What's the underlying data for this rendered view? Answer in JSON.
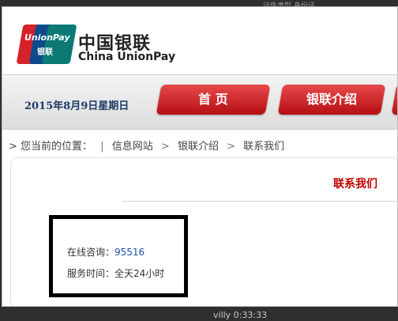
{
  "background": {
    "top_right_text": "证件类型  身份证",
    "bottom_text": "villy 0:33:33"
  },
  "brand": {
    "logo_top": "UnionPay",
    "logo_bottom": "银联",
    "name_cn": "中国银联",
    "name_en": "China UnionPay",
    "colors": {
      "red": "#d6222a",
      "blue": "#0c4a8c",
      "teal": "#0b7a74"
    }
  },
  "nav": {
    "date": "2015年8月9日星期日",
    "tabs": [
      "首 页",
      "银联介绍"
    ]
  },
  "breadcrumb": {
    "prefix": "您当前的位置：",
    "divider": "|",
    "items": [
      "信息网站",
      "银联介绍",
      "联系我们"
    ],
    "separator": ">"
  },
  "content": {
    "title": "联系我们",
    "consult_label": "在线咨询：",
    "consult_phone": "95516",
    "hours": "服务时间：全天24小时"
  }
}
